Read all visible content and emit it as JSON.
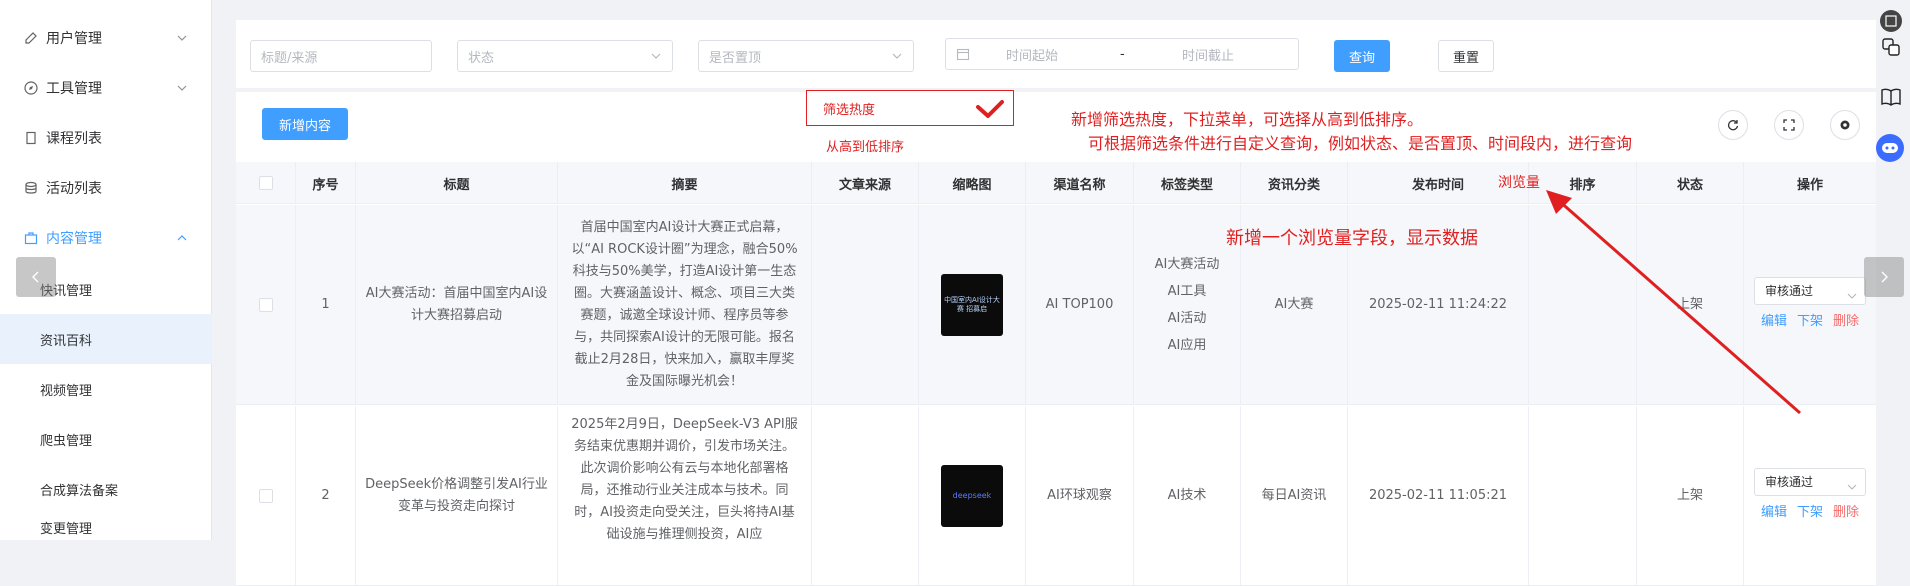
{
  "sidebar": {
    "menus": [
      {
        "label": "用户管理",
        "icon": "edit-icon",
        "expanded": false
      },
      {
        "label": "工具管理",
        "icon": "compass-icon",
        "expanded": false
      },
      {
        "label": "课程列表",
        "icon": "book-icon"
      },
      {
        "label": "活动列表",
        "icon": "database-icon"
      },
      {
        "label": "内容管理",
        "icon": "briefcase-icon",
        "expanded": true
      }
    ],
    "sub_items": [
      "快讯管理",
      "资讯百科",
      "视频管理",
      "爬虫管理",
      "合成算法备案",
      "变更管理"
    ],
    "active_sub": "资讯百科"
  },
  "filter": {
    "title_placeholder": "标题/来源",
    "status_placeholder": "状态",
    "top_placeholder": "是否置顶",
    "time_start_placeholder": "时间起始",
    "time_sep": "-",
    "time_end_placeholder": "时间截止",
    "query_label": "查询",
    "reset_label": "重置"
  },
  "toolbar": {
    "add_label": "新增内容"
  },
  "annotations": {
    "filter_box": "筛选热度",
    "sort_hint": "从高到低排序",
    "note_line1": "新增筛选热度，下拉菜单，可选择从高到低排序。",
    "note_line2": "可根据筛选条件进行自定义查询，例如状态、是否置顶、时间段内，进行查询",
    "views_label": "浏览量",
    "views_note": "新增一个浏览量字段，显示数据"
  },
  "table": {
    "headers": [
      "序号",
      "标题",
      "摘要",
      "文章来源",
      "缩略图",
      "渠道名称",
      "标签类型",
      "资讯分类",
      "发布时间",
      "排序",
      "状态",
      "操作"
    ],
    "rows": [
      {
        "index": "1",
        "title": "AI大赛活动：首届中国室内AI设计大赛招募启动",
        "summary": "首届中国室内AI设计大赛正式启幕，以“AI ROCK设计圈”为理念，融合50%科技与50%美学，打造AI设计第一生态圈。大赛涵盖设计、概念、项目三大类赛题，诚邀全球设计师、程序员等参与，共同探索AI设计的无限可能。报名截止2月28日，快来加入，赢取丰厚奖金及国际曝光机会！",
        "source": "",
        "thumb_text": "中国室内AI设计大赛 招募启",
        "channel": "AI TOP100",
        "tags": [
          "AI大赛活动",
          "AI工具",
          "AI活动",
          "AI应用"
        ],
        "category": "AI大赛",
        "publish_time": "2025-02-11 11:24:22",
        "sort": "",
        "status": "上架",
        "op_select": "审核通过",
        "op_edit": "编辑",
        "op_off": "下架",
        "op_delete": "删除"
      },
      {
        "index": "2",
        "title": "DeepSeek价格调整引发AI行业变革与投资走向探讨",
        "summary": "2025年2月9日，DeepSeek-V3 API服务结束优惠期并调价，引发市场关注。此次调价影响公有云与本地化部署格局，还推动行业关注成本与技术。同时，AI投资走向受关注，巨头将持AI基础设施与推理侧投资，AI应",
        "source": "",
        "thumb_text": "deepseek",
        "channel": "AI环球观察",
        "tags": [
          "AI技术"
        ],
        "category": "每日AI资讯",
        "publish_time": "2025-02-11 11:05:21",
        "sort": "",
        "status": "上架",
        "op_select": "审核通过",
        "op_edit": "编辑",
        "op_off": "下架",
        "op_delete": "删除"
      }
    ]
  }
}
